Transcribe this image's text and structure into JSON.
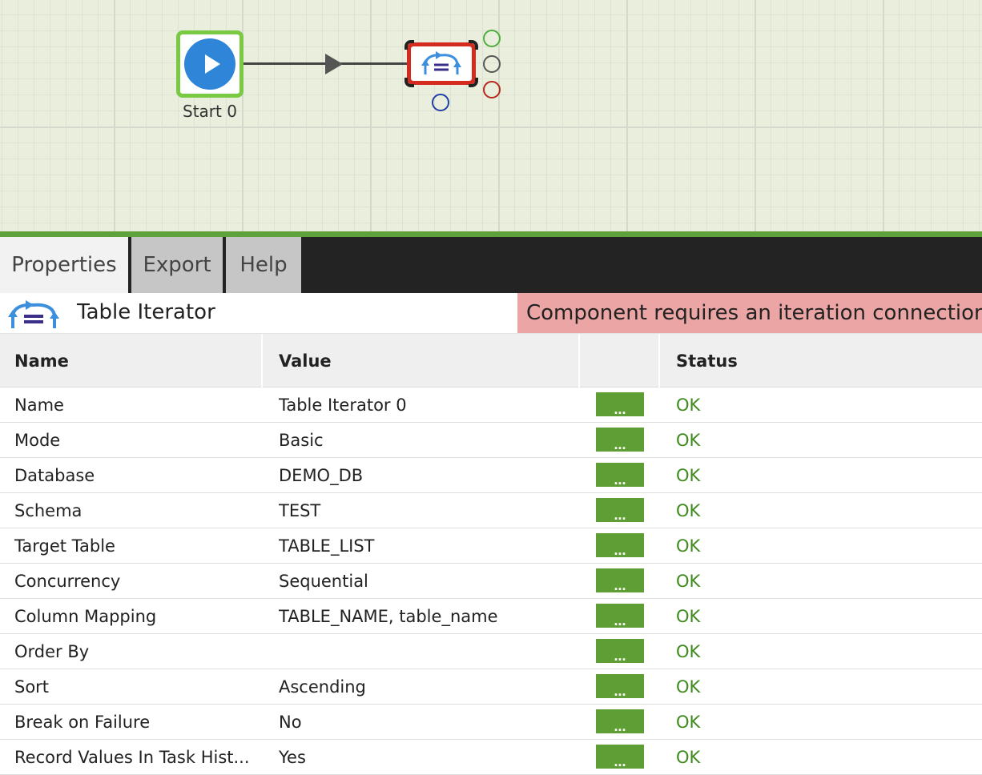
{
  "canvas": {
    "start_node": {
      "label": "Start 0",
      "icon": "play-icon"
    },
    "iterator_node": {
      "icon": "table-iterator-icon",
      "state": "error"
    },
    "ports": [
      "success",
      "unconditional",
      "failure",
      "iterate"
    ]
  },
  "tabs": [
    {
      "label": "Properties",
      "active": true
    },
    {
      "label": "Export",
      "active": false
    },
    {
      "label": "Help",
      "active": false
    }
  ],
  "component": {
    "title": "Table Iterator",
    "icon": "table-iterator-icon",
    "error": "Component requires an iteration connection."
  },
  "table": {
    "headers": {
      "name": "Name",
      "value": "Value",
      "edit": "",
      "status": "Status"
    },
    "edit_label": "...",
    "rows": [
      {
        "name": "Name",
        "value": "Table Iterator 0",
        "status": "OK"
      },
      {
        "name": "Mode",
        "value": "Basic",
        "status": "OK"
      },
      {
        "name": "Database",
        "value": "DEMO_DB",
        "status": "OK"
      },
      {
        "name": "Schema",
        "value": "TEST",
        "status": "OK"
      },
      {
        "name": "Target Table",
        "value": "TABLE_LIST",
        "status": "OK"
      },
      {
        "name": "Concurrency",
        "value": "Sequential",
        "status": "OK"
      },
      {
        "name": "Column Mapping",
        "value": "TABLE_NAME, table_name",
        "status": "OK"
      },
      {
        "name": "Order By",
        "value": "",
        "status": "OK"
      },
      {
        "name": "Sort",
        "value": "Ascending",
        "status": "OK"
      },
      {
        "name": "Break on Failure",
        "value": "No",
        "status": "OK"
      },
      {
        "name": "Record Values In Task Hist...",
        "value": "Yes",
        "status": "OK"
      }
    ]
  },
  "colors": {
    "canvas_bg": "#eaefdd",
    "start_border": "#7ac943",
    "start_fill": "#2f86d9",
    "error_border": "#d52b1e",
    "error_banner": "#eba5a5",
    "status_ok": "#3f8a1e",
    "edit_button": "#5f9e35"
  }
}
